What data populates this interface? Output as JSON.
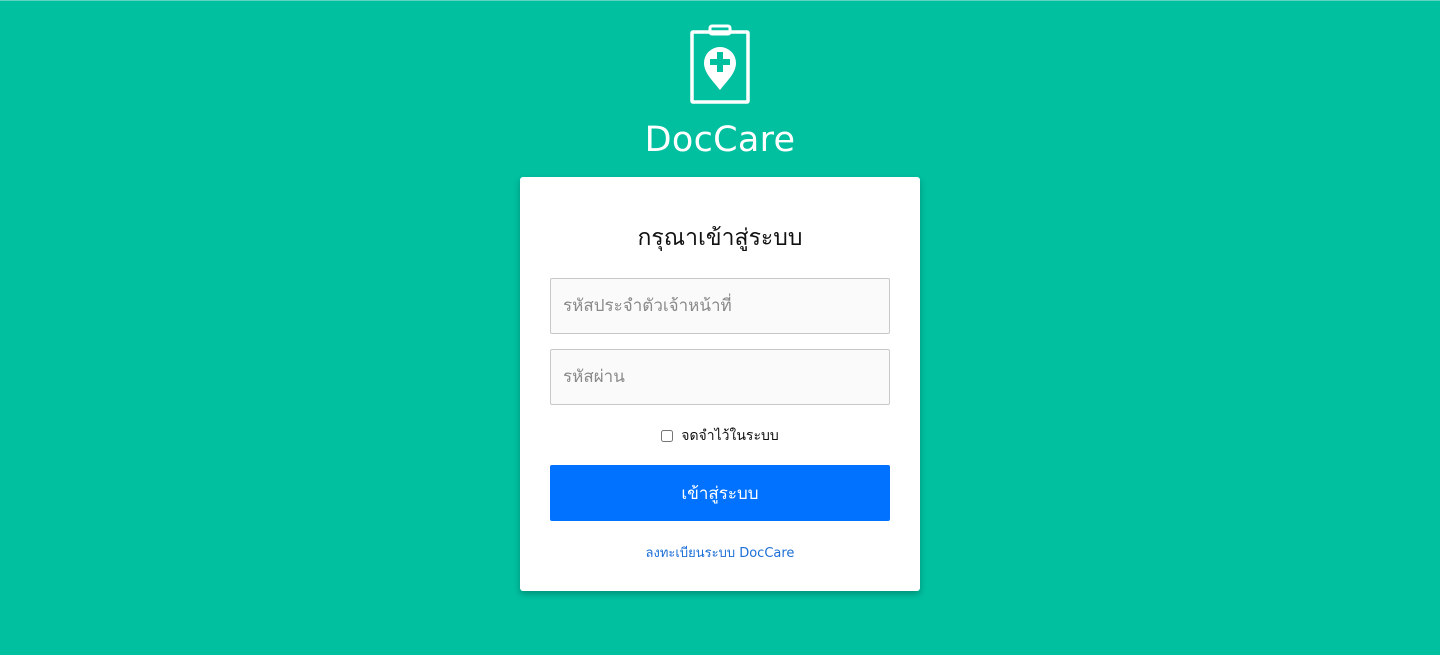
{
  "app": {
    "title": "DocCare",
    "logo": "medical-clipboard-pin-icon"
  },
  "login": {
    "heading": "กรุณาเข้าสู่ระบบ",
    "id_placeholder": "รหัสประจำตัวเจ้าหน้าที่",
    "id_value": "",
    "password_placeholder": "รหัสผ่าน",
    "password_value": "",
    "remember_label": "จดจำไว้ในระบบ",
    "remember_checked": false,
    "submit_label": "เข้าสู่ระบบ",
    "register_link": "ลงทะเบียนระบบ DocCare"
  },
  "colors": {
    "background": "#00c0a0",
    "primary_button": "#0072ff",
    "link": "#1b6fd6",
    "card": "#ffffff"
  }
}
